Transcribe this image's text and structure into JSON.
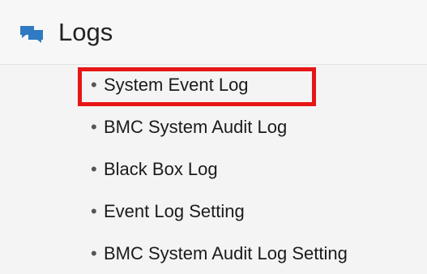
{
  "logs_header": {
    "title": "Logs",
    "icon": "chat-bubbles-icon",
    "icon_color": "#2f7ac2"
  },
  "menu": {
    "items": [
      {
        "label": "System Event Log",
        "bullet": "•",
        "highlighted": true
      },
      {
        "label": "BMC System Audit Log",
        "bullet": "•",
        "highlighted": false
      },
      {
        "label": "Black Box Log",
        "bullet": "•",
        "highlighted": false
      },
      {
        "label": "Event Log Setting",
        "bullet": "•",
        "highlighted": false
      },
      {
        "label": "BMC System Audit Log Setting",
        "bullet": "•",
        "highlighted": false
      }
    ]
  },
  "highlight": {
    "color": "#e71616"
  }
}
